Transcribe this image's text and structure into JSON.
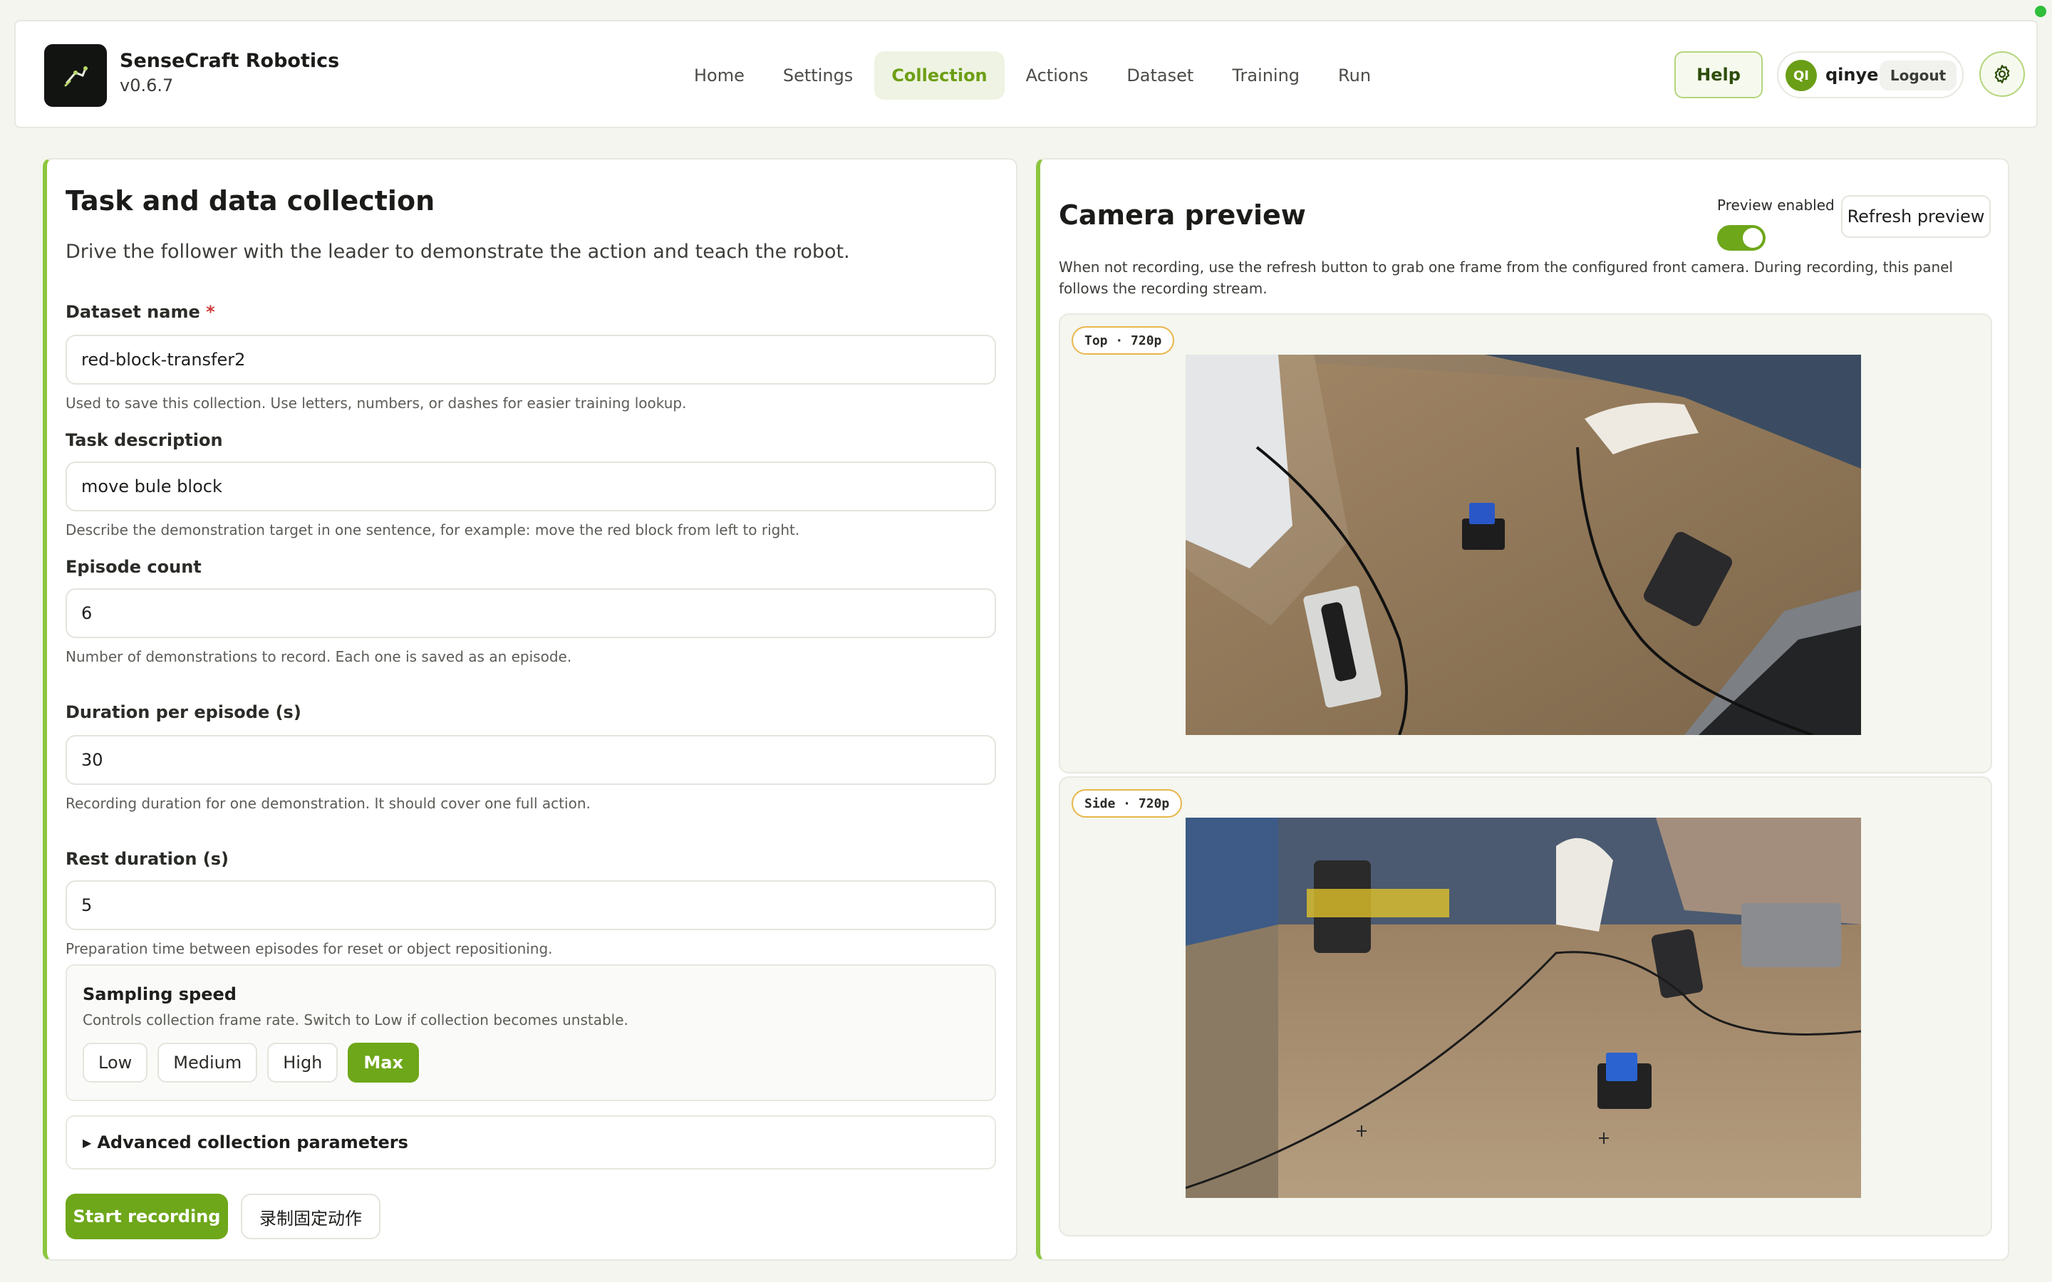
{
  "app": {
    "name": "SenseCraft Robotics",
    "version": "v0.6.7"
  },
  "nav": {
    "items": [
      "Home",
      "Settings",
      "Collection",
      "Actions",
      "Dataset",
      "Training",
      "Run"
    ],
    "active": "Collection"
  },
  "header": {
    "help_label": "Help",
    "user_initials": "QI",
    "user_name": "qinye",
    "logout_label": "Logout"
  },
  "colors": {
    "accent": "#6ea71a",
    "panel_border_accent": "#8cc63f",
    "required": "#d13b3b",
    "status_dot": "#2fbf3a"
  },
  "task": {
    "title": "Task and data collection",
    "subtitle": "Drive the follower with the leader to demonstrate the action and teach the robot.",
    "dataset_name": {
      "label": "Dataset name",
      "required_mark": "*",
      "value": "red-block-transfer2",
      "help": "Used to save this collection. Use letters, numbers, or dashes for easier training lookup."
    },
    "task_description": {
      "label": "Task description",
      "value": "move bule block",
      "help": "Describe the demonstration target in one sentence, for example: move the red block from left to right."
    },
    "episode_count": {
      "label": "Episode count",
      "value": "6",
      "help": "Number of demonstrations to record. Each one is saved as an episode."
    },
    "duration": {
      "label": "Duration per episode (s)",
      "value": "30",
      "help": "Recording duration for one demonstration. It should cover one full action."
    },
    "rest": {
      "label": "Rest duration (s)",
      "value": "5",
      "help": "Preparation time between episodes for reset or object repositioning."
    },
    "sampling": {
      "title": "Sampling speed",
      "desc": "Controls collection frame rate. Switch to Low if collection becomes unstable.",
      "options": [
        "Low",
        "Medium",
        "High",
        "Max"
      ],
      "selected": "Max"
    },
    "advanced_label": "Advanced collection parameters",
    "start_label": "Start recording",
    "fixed_action_label": "录制固定动作"
  },
  "preview": {
    "title": "Camera preview",
    "enabled_label": "Preview enabled",
    "enabled": true,
    "refresh_label": "Refresh preview",
    "desc": "When not recording, use the refresh button to grab one frame from the configured front camera. During recording, this panel follows the recording stream.",
    "cameras": [
      {
        "badge": "Top · 720p",
        "icon": "camera-feed-top"
      },
      {
        "badge": "Side · 720p",
        "icon": "camera-feed-side"
      }
    ]
  }
}
